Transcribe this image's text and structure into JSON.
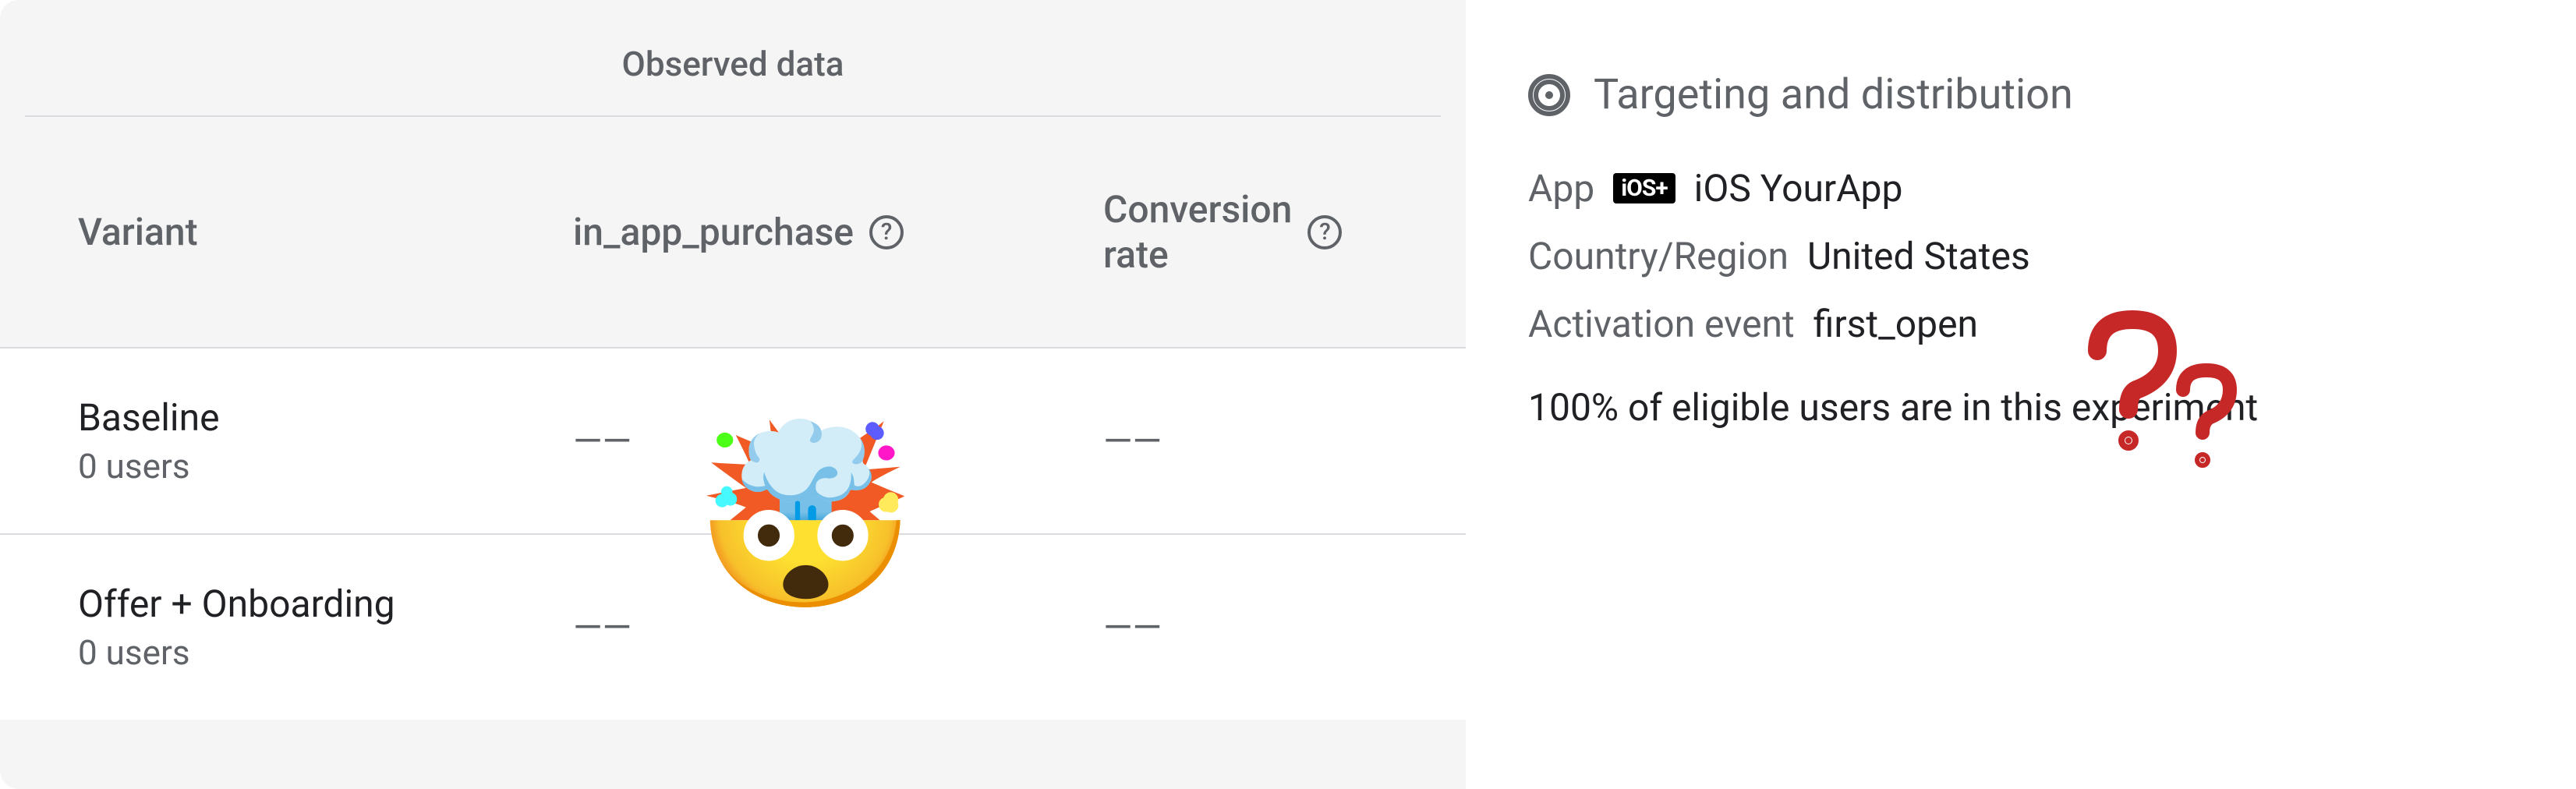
{
  "observed": {
    "title": "Observed data",
    "columns": {
      "variant": "Variant",
      "iap": "in_app_purchase",
      "conv_line1": "Conversion",
      "conv_line2": "rate"
    },
    "rows": [
      {
        "name": "Baseline",
        "users": "0 users",
        "iap": "——",
        "conv": "——"
      },
      {
        "name": "Offer + Onboarding",
        "users": "0 users",
        "iap": "——",
        "conv": "——"
      }
    ]
  },
  "targeting": {
    "title": "Targeting and distribution",
    "app_label": "App",
    "app_badge": "iOS+",
    "app_platform": "iOS",
    "app_name": "YourApp",
    "country_label": "Country/Region",
    "country_value": "United States",
    "activation_label": "Activation event",
    "activation_value": "first_open",
    "summary": "100% of eligible users are in this experiment"
  },
  "overlay": {
    "emoji": "🤯"
  }
}
